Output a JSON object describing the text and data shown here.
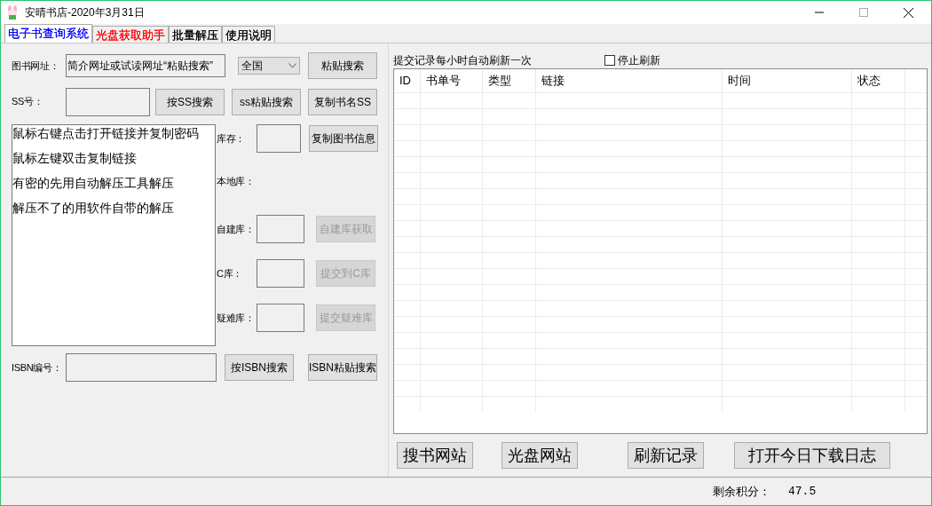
{
  "window": {
    "title": "安晴书店-2020年3月31日"
  },
  "tabs": [
    {
      "label": "电子书查询系统",
      "selected": true,
      "color": "#0000ff"
    },
    {
      "label": "光盘获取助手",
      "selected": false,
      "color": "#ff0000"
    },
    {
      "label": "批量解压",
      "selected": false,
      "color": "#000000"
    },
    {
      "label": "使用说明",
      "selected": false,
      "color": "#000000"
    }
  ],
  "url_row": {
    "label": "图书网址：",
    "value": "简介网址或试读网址“粘贴搜索”",
    "region": "全国",
    "button": "粘贴搜索"
  },
  "ss_row": {
    "label": "SS号：",
    "buttons": [
      {
        "label": "按SS搜索",
        "disabled": false
      },
      {
        "label": "ss粘贴搜索",
        "disabled": false
      },
      {
        "label": "复制书名SS",
        "disabled": false
      }
    ]
  },
  "hints": [
    "鼠标右键点击打开链接并复制密码",
    "鼠标左键双击复制链接",
    "有密的先用自动解压工具解压",
    "解压不了的用软件自带的解压"
  ],
  "stock": {
    "label": "库存：",
    "button": {
      "label": "复制图书信息",
      "disabled": false
    }
  },
  "local_label": "本地库：",
  "libraries": [
    {
      "label": "自建库：",
      "button": {
        "label": "自建库获取",
        "disabled": true
      }
    },
    {
      "label": "C库：",
      "button": {
        "label": "提交到C库",
        "disabled": true
      }
    },
    {
      "label": "疑难库：",
      "button": {
        "label": "提交疑难库",
        "disabled": true
      }
    }
  ],
  "isbn_row": {
    "label": "ISBN编号：",
    "buttons": [
      {
        "label": "按ISBN搜索",
        "disabled": false
      },
      {
        "label": "ISBN粘贴搜索",
        "disabled": false
      }
    ]
  },
  "records": {
    "title": "提交记录每小时自动刷新一次",
    "stop_refresh": {
      "label": "停止刷新",
      "checked": false
    },
    "columns": [
      "ID",
      "书单号",
      "类型",
      "链接",
      "时间",
      "状态"
    ]
  },
  "bottom_buttons": [
    "搜书网站",
    "光盘网站",
    "刷新记录",
    "打开今日下载日志"
  ],
  "status_bar": {
    "label": "剩余积分：",
    "value": "47.5"
  }
}
